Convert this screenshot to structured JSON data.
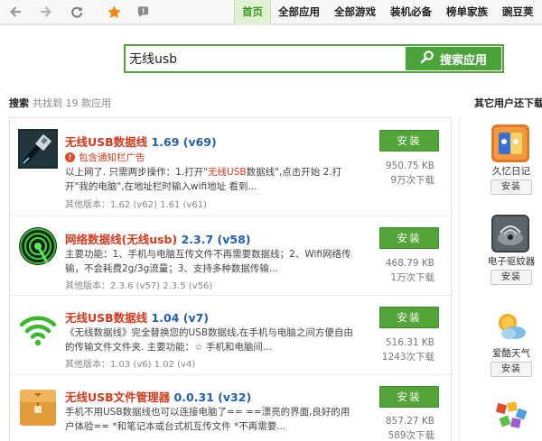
{
  "nav": {
    "tabs": [
      "首页",
      "全部应用",
      "全部游戏",
      "装机必备",
      "榜单家族",
      "豌豆荚"
    ]
  },
  "search": {
    "query": "无线usb",
    "button_label": "搜索应用"
  },
  "results_header": {
    "label": "搜索",
    "count_text": "共找到 19 款应用"
  },
  "results": [
    {
      "name": "无线USB数据线",
      "version": "1.69 (v69)",
      "ad_warning": "包含通知栏广告",
      "desc_1": "以上网了. 只需两步操作：1.打开\"",
      "desc_hl": "无线USB",
      "desc_2": "数据线\",点击开始 2.打开\"我的电脑\",在地址栏时输入wifi地址 看到...",
      "other_versions": "其他版本：1.62 (v62) 1.61 (v61)",
      "install_label": "安装",
      "size": "950.75 KB",
      "downloads": "9万次下载"
    },
    {
      "name": "网络数据线(无线usb)",
      "version": "2.3.7 (v58)",
      "description": "主要功能：1、手机与电脑互传文件不再需要数据线；2、Wifi网络传输，不会耗费2g/3g流量；3、支持多种数据传输...",
      "other_versions": "其他版本：2.3.6 (v57) 2.3.5 (v56)",
      "install_label": "安装",
      "size": "468.79 KB",
      "downloads": "1万次下载"
    },
    {
      "name": "无线USB数据线",
      "version": "1.04 (v7)",
      "description": "《无线数据线》完全替换您的USB数据线,在手机与电脑之间方便自由的传输文件文件夹. 主要功能：☆ 手机和电脑间...",
      "other_versions": "其他版本：1.03 (v6) 1.02 (v4)",
      "install_label": "安装",
      "size": "516.31 KB",
      "downloads": "1243次下载"
    },
    {
      "name": "无线USB文件管理器",
      "version": "0.0.31 (v32)",
      "description": "手机不用USB数据线也可以连接电脑了== ==漂亮的界面,良好的用户体验== *和笔记本或台式机互传文件 *不再需要...",
      "install_label": "安装",
      "size": "857.27 KB",
      "downloads": "589次下载"
    }
  ],
  "sidebar": {
    "title": "其它用户还下载了",
    "apps": [
      {
        "name": "久忆日记",
        "install_label": "安装"
      },
      {
        "name": "电子驱蚊器",
        "install_label": "安装"
      },
      {
        "name": "爱酷天气",
        "install_label": "安装"
      },
      {
        "name": "",
        "install_label": ""
      }
    ]
  },
  "colors": {
    "accent_green": "#4ba43a",
    "title_red": "#d53a1d",
    "version_blue": "#1f5fb5"
  }
}
